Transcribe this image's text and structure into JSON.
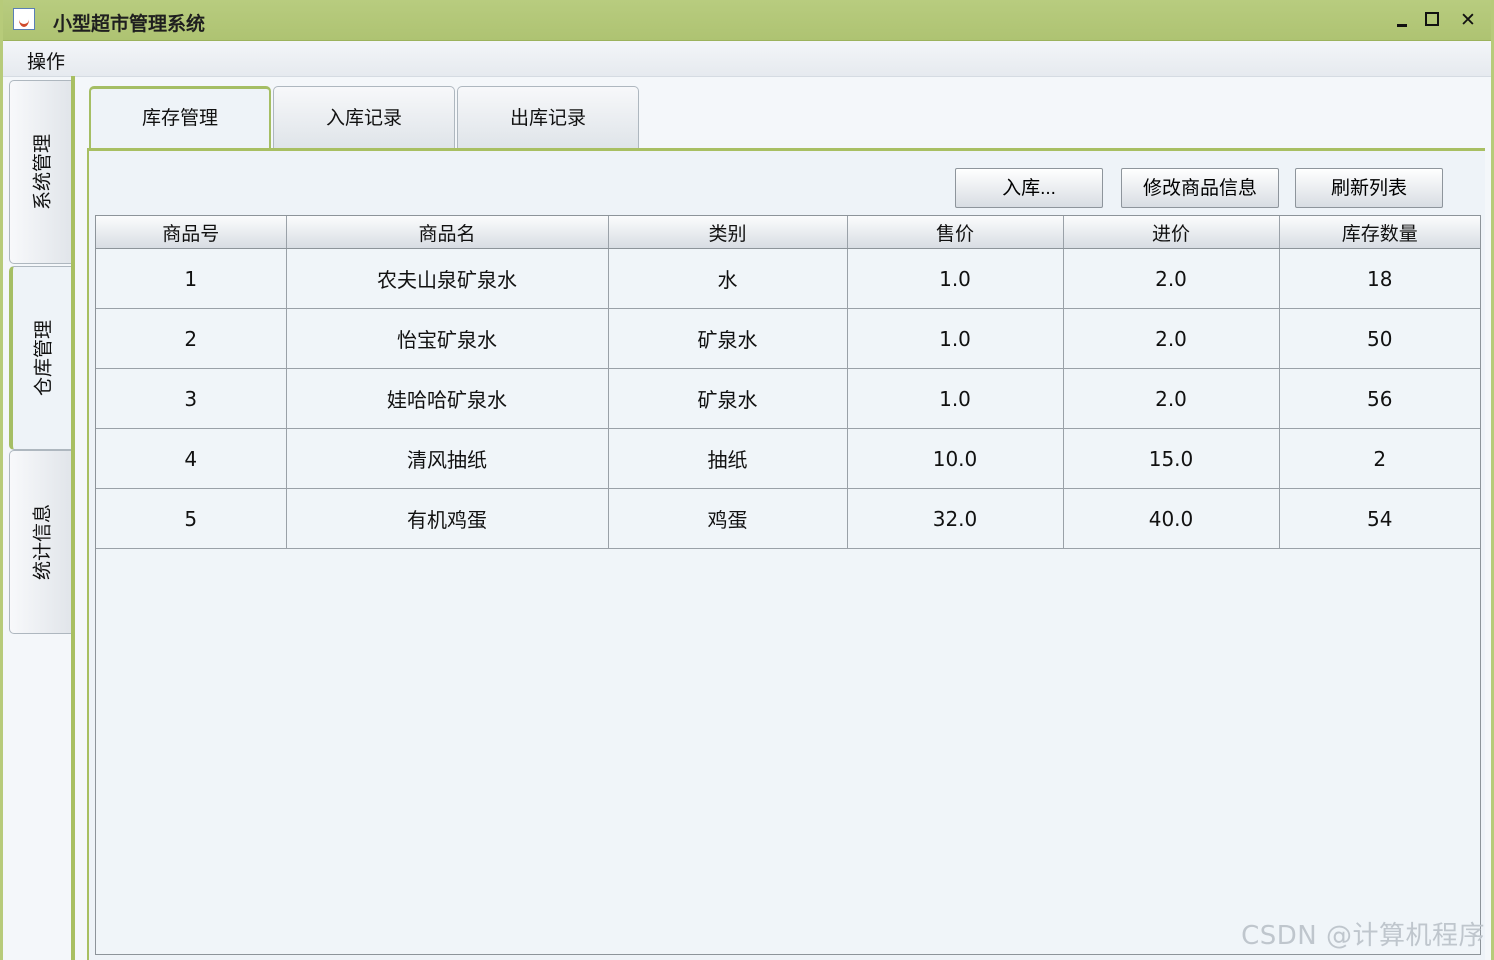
{
  "window": {
    "title": "小型超市管理系统",
    "controls": {
      "minimize_icon": "minimize-icon",
      "maximize_icon": "maximize-icon",
      "close_symbol": "✕"
    }
  },
  "menu": {
    "items": [
      {
        "label": "操作"
      }
    ]
  },
  "sidebar": {
    "tabs": [
      {
        "label": "系统管理",
        "active": false
      },
      {
        "label": "仓库管理",
        "active": true
      },
      {
        "label": "统计信息",
        "active": false
      }
    ]
  },
  "tabs": {
    "items": [
      {
        "label": "库存管理",
        "active": true
      },
      {
        "label": "入库记录",
        "active": false
      },
      {
        "label": "出库记录",
        "active": false
      }
    ]
  },
  "toolbar": {
    "in_label": "入库...",
    "edit_label": "修改商品信息",
    "refresh_label": "刷新列表"
  },
  "table": {
    "headers": [
      "商品号",
      "商品名",
      "类别",
      "售价",
      "进价",
      "库存数量"
    ],
    "rows": [
      [
        "1",
        "农夫山泉矿泉水",
        "水",
        "1.0",
        "2.0",
        "18"
      ],
      [
        "2",
        "怡宝矿泉水",
        "矿泉水",
        "1.0",
        "2.0",
        "50"
      ],
      [
        "3",
        "娃哈哈矿泉水",
        "矿泉水",
        "1.0",
        "2.0",
        "56"
      ],
      [
        "4",
        "清风抽纸",
        "抽纸",
        "10.0",
        "15.0",
        "2"
      ],
      [
        "5",
        "有机鸡蛋",
        "鸡蛋",
        "32.0",
        "40.0",
        "54"
      ]
    ]
  },
  "watermark": {
    "text": "CSDN @计算机程序"
  },
  "colors": {
    "title_bar": "#b8cc7f",
    "accent_green": "#a8bf62",
    "background": "#eef3f8",
    "border": "#8d949a"
  }
}
